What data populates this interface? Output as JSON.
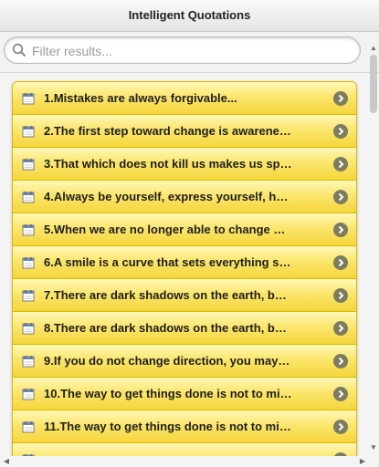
{
  "header": {
    "title": "Intelligent Quotations"
  },
  "search": {
    "placeholder": "Filter results..."
  },
  "quotes": [
    {
      "label": "1.Mistakes are always forgivable...",
      "icon": "calendar-icon"
    },
    {
      "label": "2.The first step toward change is awarene…",
      "icon": "calendar-icon"
    },
    {
      "label": "3.That which does not kill us makes us sp…",
      "icon": "calendar-icon"
    },
    {
      "label": "4.Always be yourself, express yourself, h…",
      "icon": "calendar-icon"
    },
    {
      "label": "5.When we are no longer able to change …",
      "icon": "calendar-icon"
    },
    {
      "label": "6.A smile is a curve that sets everything s…",
      "icon": "calendar-icon"
    },
    {
      "label": "7.There are dark shadows on the earth, b…",
      "icon": "calendar-icon"
    },
    {
      "label": "8.There are dark shadows on the earth, b…",
      "icon": "calendar-icon"
    },
    {
      "label": "9.If you do not change direction, you may…",
      "icon": "calendar-icon"
    },
    {
      "label": "10.The way to get things done is not to mi…",
      "icon": "calendar-icon"
    },
    {
      "label": "11.The way to get things done is not to mi…",
      "icon": "calendar-icon"
    },
    {
      "label": "",
      "icon": "calendar-icon"
    }
  ],
  "colors": {
    "row_top": "#fff8b8",
    "row_bottom": "#f5d63c",
    "row_border": "#d9b900",
    "arrow_bg": "#7c7c5e"
  },
  "scroll_icons": {
    "up": "▲",
    "down": "▼",
    "left": "◀",
    "right": "▶"
  }
}
